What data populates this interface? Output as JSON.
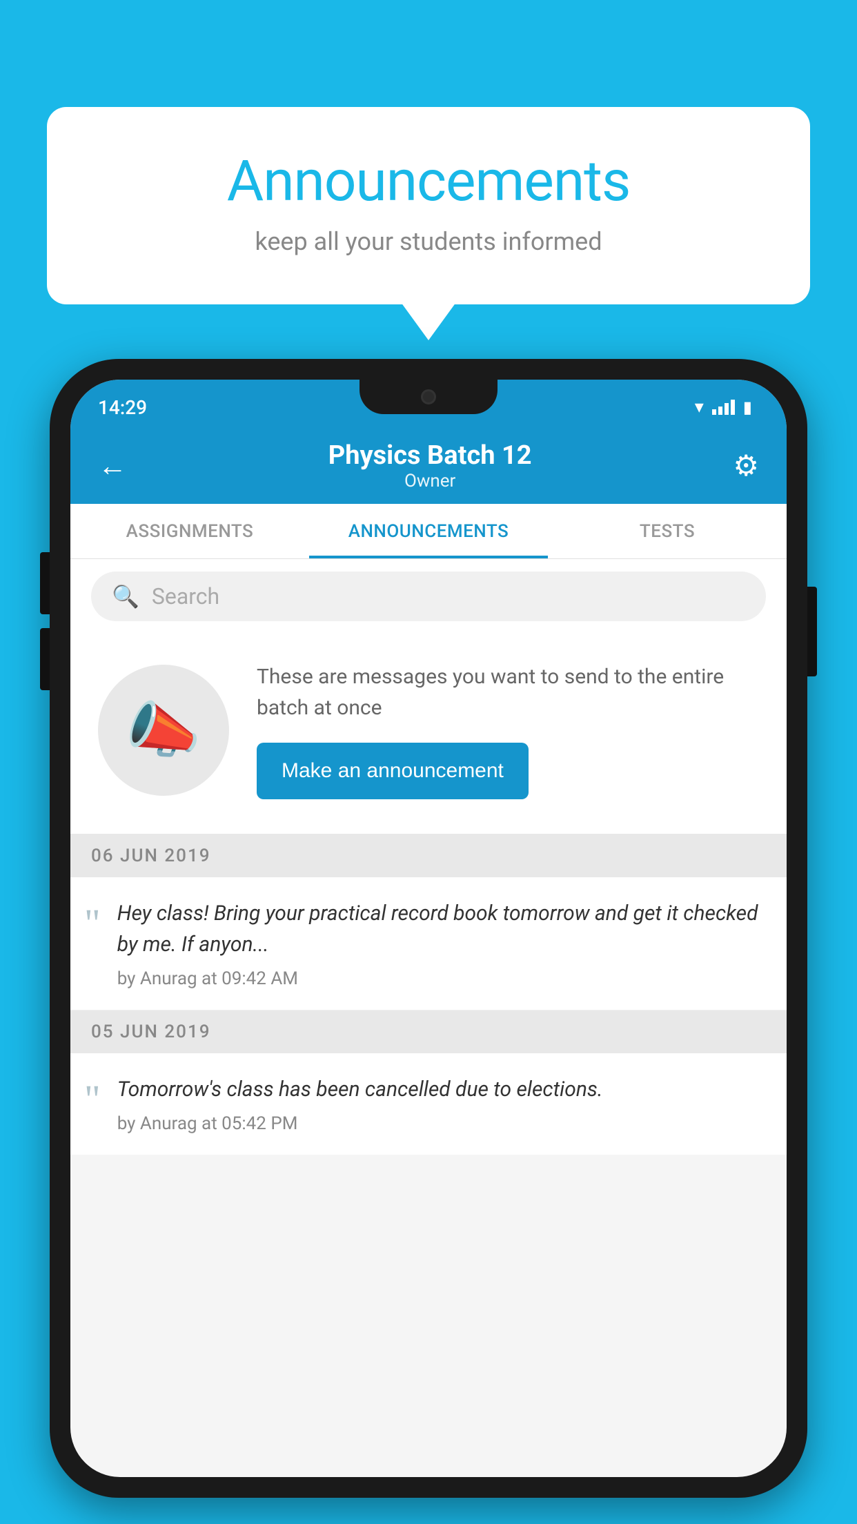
{
  "page": {
    "background_color": "#1ab8e8"
  },
  "speech_bubble": {
    "title": "Announcements",
    "subtitle": "keep all your students informed"
  },
  "phone": {
    "status_bar": {
      "time": "14:29"
    },
    "header": {
      "title": "Physics Batch 12",
      "subtitle": "Owner",
      "back_label": "←",
      "gear_label": "⚙"
    },
    "tabs": [
      {
        "label": "ASSIGNMENTS",
        "active": false
      },
      {
        "label": "ANNOUNCEMENTS",
        "active": true
      },
      {
        "label": "TESTS",
        "active": false
      }
    ],
    "search": {
      "placeholder": "Search"
    },
    "announcement_prompt": {
      "description": "These are messages you want to send to the entire batch at once",
      "button_label": "Make an announcement"
    },
    "date_sections": [
      {
        "date": "06  JUN  2019",
        "announcements": [
          {
            "text": "Hey class! Bring your practical record book tomorrow and get it checked by me. If anyon...",
            "meta": "by Anurag at 09:42 AM"
          }
        ]
      },
      {
        "date": "05  JUN  2019",
        "announcements": [
          {
            "text": "Tomorrow's class has been cancelled due to elections.",
            "meta": "by Anurag at 05:42 PM"
          }
        ]
      }
    ]
  }
}
